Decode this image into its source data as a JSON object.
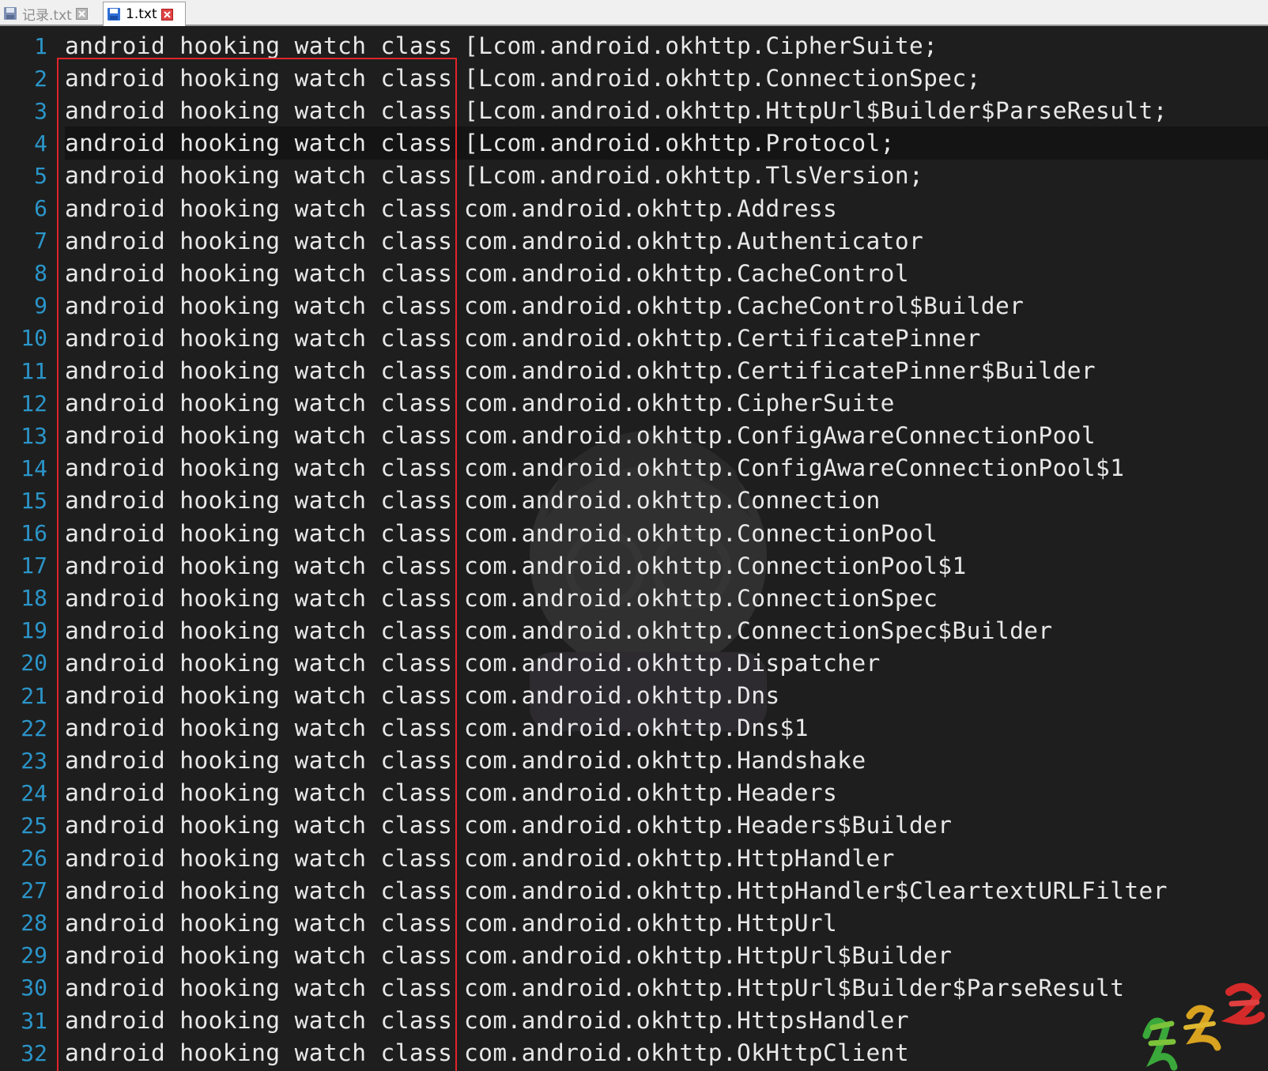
{
  "tabs": [
    {
      "label": "记录.txt",
      "active": false,
      "icon": "disk-icon",
      "close_icon": "close-icon"
    },
    {
      "label": "1.txt",
      "active": true,
      "icon": "disk-icon",
      "close_icon": "close-icon"
    }
  ],
  "editor": {
    "current_line": 4,
    "lines": [
      {
        "num": "1",
        "prefix": "android hooking watch class",
        "rest": "[Lcom.android.okhttp.CipherSuite;"
      },
      {
        "num": "2",
        "prefix": "android hooking watch class",
        "rest": "[Lcom.android.okhttp.ConnectionSpec;"
      },
      {
        "num": "3",
        "prefix": "android hooking watch class",
        "rest": "[Lcom.android.okhttp.HttpUrl$Builder$ParseResult;"
      },
      {
        "num": "4",
        "prefix": "android hooking watch class",
        "rest": "[Lcom.android.okhttp.Protocol;"
      },
      {
        "num": "5",
        "prefix": "android hooking watch class",
        "rest": "[Lcom.android.okhttp.TlsVersion;"
      },
      {
        "num": "6",
        "prefix": "android hooking watch class",
        "rest": "com.android.okhttp.Address"
      },
      {
        "num": "7",
        "prefix": "android hooking watch class",
        "rest": "com.android.okhttp.Authenticator"
      },
      {
        "num": "8",
        "prefix": "android hooking watch class",
        "rest": "com.android.okhttp.CacheControl"
      },
      {
        "num": "9",
        "prefix": "android hooking watch class",
        "rest": "com.android.okhttp.CacheControl$Builder"
      },
      {
        "num": "10",
        "prefix": "android hooking watch class",
        "rest": "com.android.okhttp.CertificatePinner"
      },
      {
        "num": "11",
        "prefix": "android hooking watch class",
        "rest": "com.android.okhttp.CertificatePinner$Builder"
      },
      {
        "num": "12",
        "prefix": "android hooking watch class",
        "rest": "com.android.okhttp.CipherSuite"
      },
      {
        "num": "13",
        "prefix": "android hooking watch class",
        "rest": "com.android.okhttp.ConfigAwareConnectionPool"
      },
      {
        "num": "14",
        "prefix": "android hooking watch class",
        "rest": "com.android.okhttp.ConfigAwareConnectionPool$1"
      },
      {
        "num": "15",
        "prefix": "android hooking watch class",
        "rest": "com.android.okhttp.Connection"
      },
      {
        "num": "16",
        "prefix": "android hooking watch class",
        "rest": "com.android.okhttp.ConnectionPool"
      },
      {
        "num": "17",
        "prefix": "android hooking watch class",
        "rest": "com.android.okhttp.ConnectionPool$1"
      },
      {
        "num": "18",
        "prefix": "android hooking watch class",
        "rest": "com.android.okhttp.ConnectionSpec"
      },
      {
        "num": "19",
        "prefix": "android hooking watch class",
        "rest": "com.android.okhttp.ConnectionSpec$Builder"
      },
      {
        "num": "20",
        "prefix": "android hooking watch class",
        "rest": "com.android.okhttp.Dispatcher"
      },
      {
        "num": "21",
        "prefix": "android hooking watch class",
        "rest": "com.android.okhttp.Dns"
      },
      {
        "num": "22",
        "prefix": "android hooking watch class",
        "rest": "com.android.okhttp.Dns$1"
      },
      {
        "num": "23",
        "prefix": "android hooking watch class",
        "rest": "com.android.okhttp.Handshake"
      },
      {
        "num": "24",
        "prefix": "android hooking watch class",
        "rest": "com.android.okhttp.Headers"
      },
      {
        "num": "25",
        "prefix": "android hooking watch class",
        "rest": "com.android.okhttp.Headers$Builder"
      },
      {
        "num": "26",
        "prefix": "android hooking watch class",
        "rest": "com.android.okhttp.HttpHandler"
      },
      {
        "num": "27",
        "prefix": "android hooking watch class",
        "rest": "com.android.okhttp.HttpHandler$CleartextURLFilter"
      },
      {
        "num": "28",
        "prefix": "android hooking watch class",
        "rest": "com.android.okhttp.HttpUrl"
      },
      {
        "num": "29",
        "prefix": "android hooking watch class",
        "rest": "com.android.okhttp.HttpUrl$Builder"
      },
      {
        "num": "30",
        "prefix": "android hooking watch class",
        "rest": "com.android.okhttp.HttpUrl$Builder$ParseResult"
      },
      {
        "num": "31",
        "prefix": "android hooking watch class",
        "rest": "com.android.okhttp.HttpsHandler"
      },
      {
        "num": "32",
        "prefix": "android hooking watch class",
        "rest": "com.android.okhttp.OkHttpClient"
      }
    ]
  },
  "annotation": {
    "color": "#e0242a"
  },
  "watermark": {
    "text": "夏洛魂"
  },
  "colors": {
    "background": "#1e1e1e",
    "text": "#e8e8e8",
    "line_number": "#2b95c9",
    "current_line": "#141414"
  }
}
